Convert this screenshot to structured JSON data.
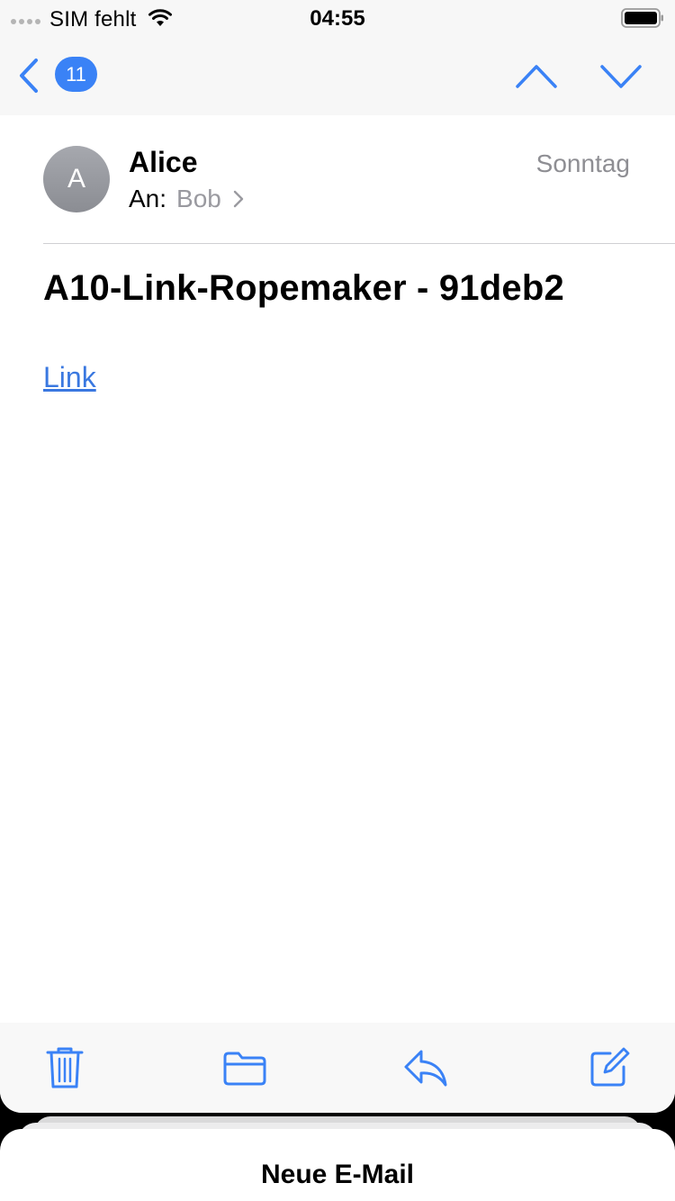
{
  "status_bar": {
    "carrier": "SIM fehlt",
    "time": "04:55",
    "icons": [
      "signal-dots-icon",
      "wifi-icon",
      "battery-icon"
    ]
  },
  "nav": {
    "unread_count": "11",
    "icons": [
      "chevron-left-icon",
      "chevron-up-icon",
      "chevron-down-icon"
    ]
  },
  "message": {
    "avatar_initial": "A",
    "sender": "Alice",
    "date": "Sonntag",
    "to_label": "An:",
    "recipient": "Bob",
    "subject": "A10-Link-Ropemaker - 91deb2",
    "body_link": "Link"
  },
  "toolbar": {
    "icons": [
      "trash-icon",
      "folder-icon",
      "reply-icon",
      "compose-icon"
    ]
  },
  "compose_drawer": {
    "title": "Neue E-Mail"
  },
  "colors": {
    "accent": "#3a82f6",
    "link": "#3a78e0",
    "secondary_text": "#8e8e93"
  }
}
